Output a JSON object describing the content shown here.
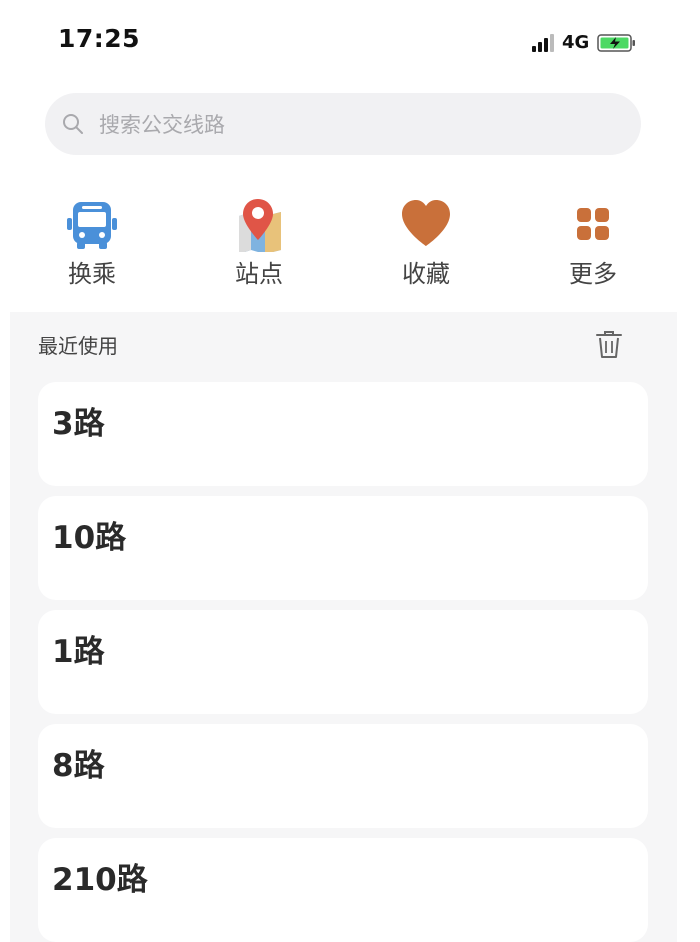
{
  "status_bar": {
    "time": "17:25",
    "network": "4G"
  },
  "search": {
    "placeholder": "搜索公交线路"
  },
  "quick_nav": [
    {
      "label": "换乘",
      "icon": "bus-icon"
    },
    {
      "label": "站点",
      "icon": "map-pin-icon"
    },
    {
      "label": "收藏",
      "icon": "heart-icon"
    },
    {
      "label": "更多",
      "icon": "grid-icon"
    }
  ],
  "recent": {
    "title": "最近使用",
    "routes": [
      "3路",
      "10路",
      "1路",
      "8路",
      "210路"
    ]
  },
  "colors": {
    "bus_blue": "#4a90d9",
    "heart_orange": "#c9703a",
    "pin_red": "#e05547",
    "battery_green": "#4cd964"
  }
}
